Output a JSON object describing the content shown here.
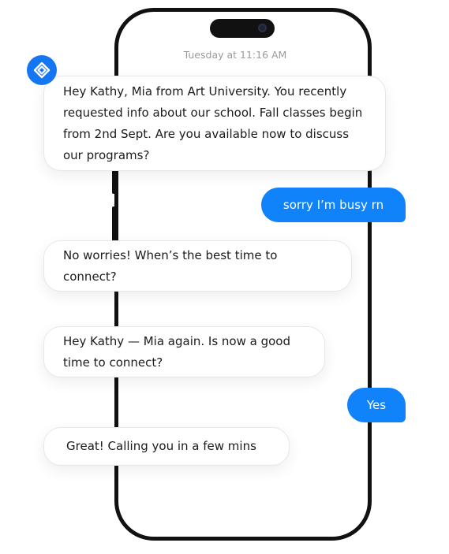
{
  "timestamp": "Tuesday at 11:16 AM",
  "brand": {
    "icon": "diamond-logo-icon",
    "color": "#1476f2"
  },
  "messages": [
    {
      "from": "agent",
      "text": "Hey Kathy, Mia from Art University. You recently requested info about our school. Fall classes begin from 2nd Sept. Are you available now to discuss our programs?"
    },
    {
      "from": "user",
      "text": "sorry I’m busy rn"
    },
    {
      "from": "agent",
      "text": "No worries! When’s the best time to connect?"
    },
    {
      "from": "agent",
      "text": "Hey Kathy — Mia again. Is now a good time to connect?"
    },
    {
      "from": "user",
      "text": "Yes"
    },
    {
      "from": "agent",
      "text": "Great! Calling you in a few mins"
    }
  ],
  "colors": {
    "outgoing_bubble": "#1083fb",
    "incoming_bubble": "#ffffff",
    "phone_frame": "#111111"
  }
}
